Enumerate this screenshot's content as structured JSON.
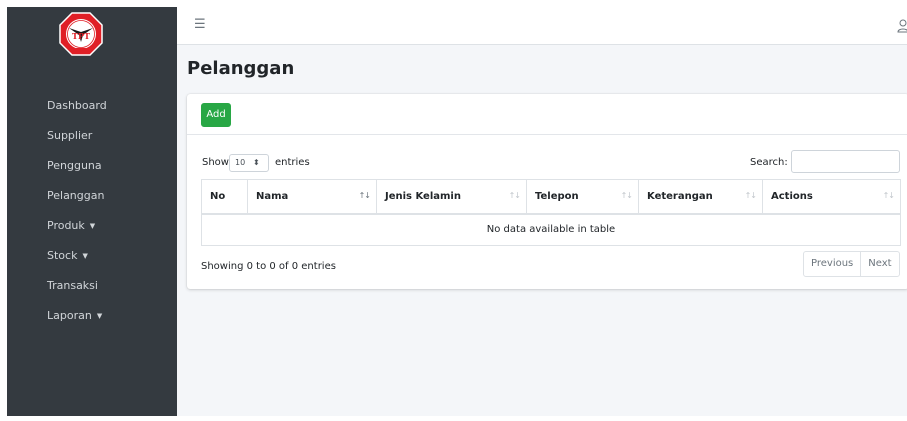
{
  "brand": {
    "logo_text": "TPT"
  },
  "sidebar": {
    "items": [
      {
        "label": "Dashboard",
        "has_caret": false
      },
      {
        "label": "Supplier",
        "has_caret": false
      },
      {
        "label": "Pengguna",
        "has_caret": false
      },
      {
        "label": "Pelanggan",
        "has_caret": false
      },
      {
        "label": "Produk",
        "has_caret": true
      },
      {
        "label": "Stock",
        "has_caret": true
      },
      {
        "label": "Transaksi",
        "has_caret": false
      },
      {
        "label": "Laporan",
        "has_caret": true
      }
    ]
  },
  "page": {
    "title": "Pelanggan"
  },
  "card": {
    "add_label": "Add",
    "length": {
      "show": "Show",
      "value": "10",
      "entries": "entries"
    },
    "search": {
      "label": "Search:",
      "value": ""
    },
    "table": {
      "columns": [
        "No",
        "Nama",
        "Jenis Kelamin",
        "Telepon",
        "Keterangan",
        "Actions"
      ],
      "empty_message": "No data available in table"
    },
    "info": "Showing 0 to 0 of 0 entries",
    "pagination": {
      "previous": "Previous",
      "next": "Next"
    }
  },
  "colors": {
    "sidebar_bg": "#343a40",
    "content_bg": "#f4f6f9",
    "primary_action": "#28a745",
    "logo_red": "#e01f26"
  },
  "icons": [
    "menu-icon",
    "user-icon",
    "sort-icon",
    "caret-down-icon"
  ]
}
